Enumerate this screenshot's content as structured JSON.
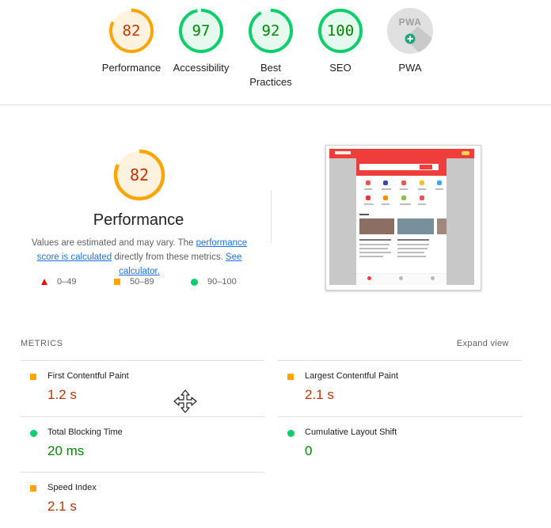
{
  "top_gauges": [
    {
      "score": "82",
      "label": "Performance",
      "status": "average",
      "fraction": 0.82
    },
    {
      "score": "97",
      "label": "Accessibility",
      "status": "pass",
      "fraction": 0.97
    },
    {
      "score": "92",
      "label": "Best Practices",
      "status": "pass",
      "fraction": 0.92
    },
    {
      "score": "100",
      "label": "SEO",
      "status": "pass",
      "fraction": 1.0
    },
    {
      "score": "",
      "label": "PWA",
      "status": "na",
      "badge": "PWA"
    }
  ],
  "performance": {
    "score": "82",
    "fraction": 0.82,
    "title": "Performance",
    "desc_text_1": "Values are estimated and may vary. The ",
    "desc_link_1": "performance score is calculated",
    "desc_text_2": " directly from these metrics. ",
    "desc_link_2": "See calculator."
  },
  "legend": [
    {
      "shape": "triangle-icon",
      "range": "0–49",
      "color": "#eb0f00"
    },
    {
      "shape": "square-icon",
      "range": "50–89",
      "color": "#ffa400"
    },
    {
      "shape": "circle-icon",
      "range": "90–100",
      "color": "#0cce6b"
    }
  ],
  "metrics_section": {
    "header": "METRICS",
    "expand_label": "Expand view"
  },
  "metrics": [
    {
      "name": "First Contentful Paint",
      "value": "1.2 s",
      "status": "average"
    },
    {
      "name": "Largest Contentful Paint",
      "value": "2.1 s",
      "status": "average"
    },
    {
      "name": "Total Blocking Time",
      "value": "20 ms",
      "status": "pass"
    },
    {
      "name": "Cumulative Layout Shift",
      "value": "0",
      "status": "pass"
    },
    {
      "name": "Speed Index",
      "value": "2.1 s",
      "status": "average"
    }
  ],
  "colors": {
    "average_ring": "#ffa400",
    "average_text": "#c33300",
    "average_fill": "#fff3e0",
    "pass_ring": "#0cce6b",
    "pass_text": "#008800",
    "pass_fill": "#e6f9ee",
    "link": "#1a73e8"
  },
  "thumbnail_icon": "page-screenshot-icon",
  "cursor_icon": "move-cursor-icon"
}
